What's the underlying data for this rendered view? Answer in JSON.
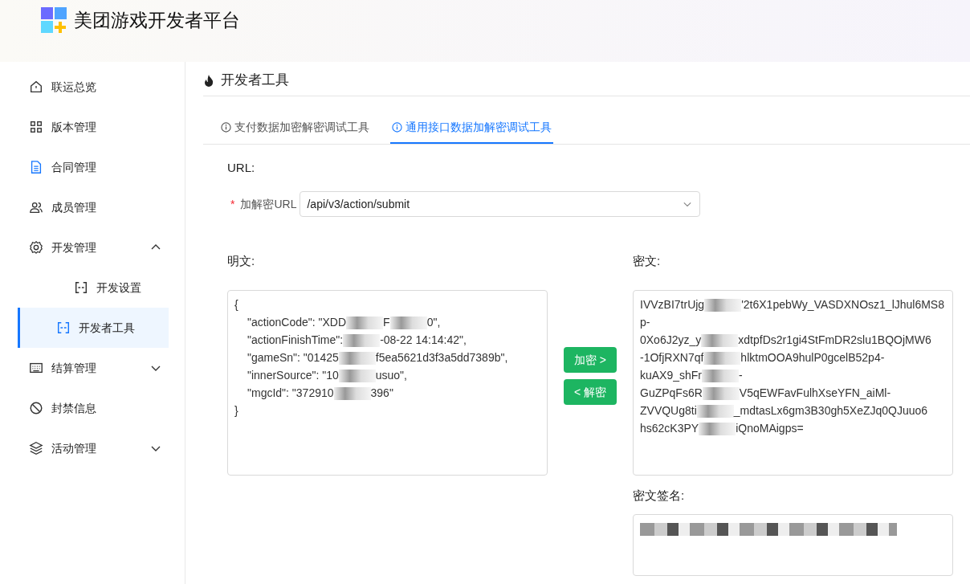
{
  "app": {
    "title": "美团游戏开发者平台"
  },
  "sidebar": {
    "items": [
      {
        "label": "联运总览",
        "selected": false
      },
      {
        "label": "版本管理",
        "selected": false
      },
      {
        "label": "合同管理",
        "selected": false
      },
      {
        "label": "成员管理",
        "selected": false
      },
      {
        "label": "开发管理",
        "selected": false,
        "expanded": true,
        "children": [
          {
            "label": "开发设置",
            "selected": false
          },
          {
            "label": "开发者工具",
            "selected": true
          }
        ]
      },
      {
        "label": "结算管理",
        "selected": false,
        "expanded": false
      },
      {
        "label": "封禁信息",
        "selected": false
      },
      {
        "label": "活动管理",
        "selected": false,
        "expanded": false
      }
    ]
  },
  "page": {
    "title": "开发者工具"
  },
  "tabs": [
    {
      "label": "支付数据加密解密调试工具",
      "selected": false
    },
    {
      "label": "通用接口数据加解密调试工具",
      "selected": true
    }
  ],
  "url_section": {
    "heading": "URL:",
    "field_label": "加解密URL",
    "required_mark": "*",
    "value": "/api/v3/action/submit"
  },
  "plaintext": {
    "heading": "明文:",
    "lines": [
      {
        "indent": false,
        "parts": [
          "{"
        ]
      },
      {
        "indent": true,
        "parts": [
          "\"actionCode\": \"XDD",
          "F",
          "0\","
        ]
      },
      {
        "indent": true,
        "parts": [
          "\"actionFinishTime\":",
          "-08-22 14:14:42\","
        ]
      },
      {
        "indent": true,
        "parts": [
          "\"gameSn\": \"01425",
          "f5ea5621d3f3a5dd7389b\","
        ]
      },
      {
        "indent": true,
        "parts": [
          "\"innerSource\": \"10",
          "usuo\","
        ]
      },
      {
        "indent": true,
        "parts": [
          "\"mgcId\": \"372910",
          "396\""
        ]
      },
      {
        "indent": false,
        "parts": [
          "}"
        ]
      }
    ]
  },
  "actions": [
    {
      "label": "加密 >"
    },
    {
      "label": "< 解密"
    }
  ],
  "ciphertext": {
    "heading": "密文:",
    "lines": [
      {
        "parts": [
          "IVVzBI7trUjg",
          "'2t6X1pebWy_VASDXNOsz1_lJhul6MS8"
        ]
      },
      {
        "parts": [
          "p-"
        ]
      },
      {
        "parts": [
          "0Xo6J2yz_y",
          "xdtpfDs2r1gi4StFmDR2slu1BQOjMW6"
        ]
      },
      {
        "parts": [
          "-1OfjRXN7qf",
          "hlktmOOA9hulP0gcelB52p4-"
        ]
      },
      {
        "parts": [
          "kuAX9_shFr",
          "-"
        ]
      },
      {
        "parts": [
          "GuZPqFs6R",
          "V5qEWFavFulhXseYFN_aiMl-"
        ]
      },
      {
        "parts": [
          "ZVVQUg8ti",
          "_mdtasLx6gm3B30gh5XeZJq0QJuuo6"
        ]
      },
      {
        "parts": [
          "hs62cK3PY",
          "iQnoMAigps="
        ]
      }
    ]
  },
  "signature": {
    "heading": "密文签名:",
    "redacted": true
  }
}
